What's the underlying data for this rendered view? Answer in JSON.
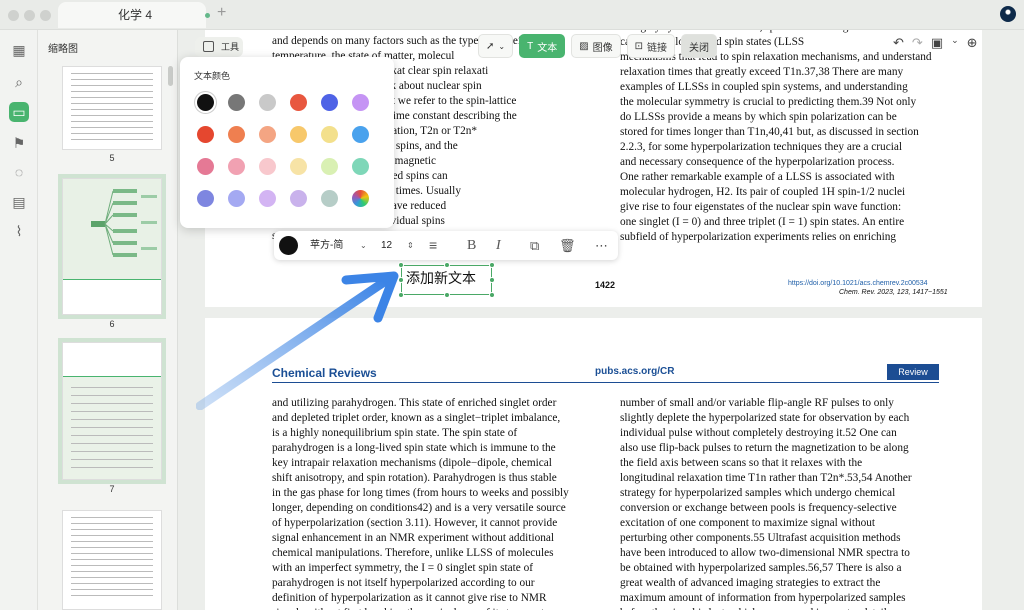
{
  "window": {
    "tab_title": "化学 4"
  },
  "rail": {
    "icons": [
      "grid-icon",
      "search-icon",
      "pages-icon",
      "bookmark-icon",
      "comment-icon",
      "document-icon",
      "attachment-icon"
    ]
  },
  "thumbnails": {
    "title": "缩略图",
    "pages": [
      {
        "label": "5"
      },
      {
        "label": "6"
      },
      {
        "label": "7"
      }
    ]
  },
  "toolbar": {
    "tools_label": "工具",
    "text_label": "文本",
    "image_label": "图像",
    "link_label": "链接",
    "close_label": "关闭"
  },
  "color_panel": {
    "title": "文本颜色",
    "colors": [
      "#111111",
      "#777777",
      "#c9c9c9",
      "#e8573f",
      "#4f63e6",
      "#c594f4",
      "#e5472f",
      "#ef7f50",
      "#f4a583",
      "#f7c86b",
      "#f3e08c",
      "#4aa2ed",
      "#e57995",
      "#f1a1b2",
      "#f8c8cd",
      "#f7e3a6",
      "#d9f0b3",
      "#7ed7b8",
      "#7e86e0",
      "#a4a9f2",
      "#d3b4f3",
      "#c9b2ec",
      "#b6cdc7",
      "rainbow"
    ]
  },
  "format_bar": {
    "color": "#111111",
    "font": "苹方-简",
    "size": "12"
  },
  "new_text": "添加新文本",
  "page_top": {
    "left_col": [
      "and depends on many factors such as the type of nuclei,",
      "temperature, the state of matter, molecul",
      "fields. Therefore,  spin relaxat clear spin relaxati",
      "[spin]  3-35 When we speak about nuclear spin",
      "relaxation, usually than not we refer to the spin-lattice",
      "relaxation time T1, or the time constant describing the",
      "radio frequency (RF) excitation, T2n or T2n*",
      "constant of an ensemble of spins, and the",
      "caused by a distribution of magnetic",
      "(the spins), although coupled spins can",
      "exhibit different relaxation times. Usually",
      "of many correlated spins have reduced",
      "relaxation rates of the individual spins",
      "state relaxation,36 but this is not always"
    ],
    "right_col": [
      "in highly symmetric molecules, species containing this",
      "can support long-lived spin states (LLSS",
      "mechanisms that lead to spin relaxation mechanisms, and understand",
      "relaxation times that greatly exceed T1n.37,38 There are many",
      "examples of LLSSs in coupled spin systems, and understanding",
      "the molecular symmetry is crucial to predicting them.39 Not only",
      "do LLSSs provide a means by which spin polarization can be",
      "stored for times longer than T1n,40,41 but, as discussed in section",
      "2.2.3, for some hyperpolarization techniques they are a crucial",
      "and necessary consequence of the hyperpolarization process.",
      "One rather remarkable example of a LLSS is associated with",
      "molecular hydrogen, H2. Its pair of coupled 1H spin-1/2 nuclei",
      "give rise to four eigenstates of the nuclear spin wave function:",
      "one singlet (I = 0) and three triplet (I = 1) spin states. An entire",
      "subfield of hyperpolarization experiments relies on enriching"
    ],
    "page_number": "1422",
    "doi": "https://doi.org/10.1021/acs.chemrev.2c00534",
    "citation": "Chem. Rev. 2023, 123, 1417−1551"
  },
  "page_bottom": {
    "journal": "Chemical Reviews",
    "site": "pubs.acs.org/CR",
    "badge": "Review",
    "left_col": [
      "and utilizing parahydrogen. This state of enriched singlet order",
      "and depleted triplet order, known as a singlet−triplet imbalance,",
      "is a highly nonequilibrium spin state. The spin state of",
      "parahydrogen is a long-lived spin state which is immune to the",
      "key intrapair relaxation mechanisms (dipole−dipole, chemical",
      "shift anisotropy, and spin rotation). Parahydrogen is thus stable",
      "in the gas phase for long times (from hours to weeks and possibly",
      "longer, depending on conditions42) and is a very versatile source",
      "of hyperpolarization (section 3.11). However, it cannot provide",
      "signal enhancement in an NMR experiment without additional",
      "chemical manipulations. Therefore, unlike LLSS of molecules",
      "with an imperfect symmetry, the I = 0 singlet spin state of",
      "parahydrogen is not itself hyperpolarized according to our",
      "definition of hyperpolarization as it cannot give rise to NMR",
      "signals without first breaking the equivalence of its two protons"
    ],
    "right_col": [
      "number of small and/or variable flip-angle RF pulses to only",
      "slightly deplete the hyperpolarized state for observation by each",
      "individual pulse without completely destroying it.52 One can",
      "also use flip-back pulses to return the magnetization to be along",
      "the field axis between scans so that it relaxes with the",
      "longitudinal relaxation time T1n rather than T2n*.53,54 Another",
      "strategy for hyperpolarized samples which undergo chemical",
      "conversion or exchange between pools is frequency-selective",
      "excitation of one component to maximize signal without",
      "perturbing other components.55 Ultrafast acquisition methods",
      "have been introduced to allow two-dimensional NMR spectra to",
      "be obtained with hyperpolarized samples.56,57 There is also a",
      "great wealth of advanced imaging strategies to extract the",
      "maximum amount of information from hyperpolarized samples",
      "before the signal is lost, which are covered in greater detail"
    ]
  }
}
